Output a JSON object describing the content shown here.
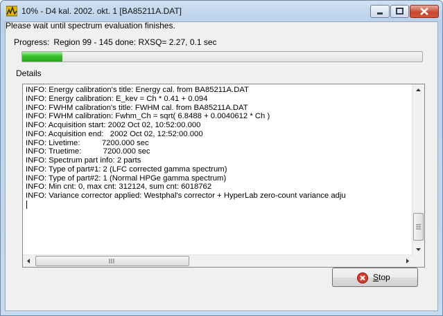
{
  "window": {
    "title": "10% - D4 kal. 2002. okt. 1 [BA85211A.DAT]"
  },
  "message": "Please wait until spectrum evaluation finishes.",
  "progress": {
    "label": "Progress:",
    "value_text": "Region 99 - 145 done: RXSQ= 2.27, 0.1 sec",
    "fraction": 0.1
  },
  "details": {
    "label": "Details",
    "lines": [
      "INFO: Energy calibration's title: Energy cal. from BA85211A.DAT",
      "INFO: Energy calibration: E_kev = Ch * 0.41 + 0.094",
      "INFO: FWHM calibration's title: FWHM cal. from BA85211A.DAT",
      "INFO: FWHM calibration: Fwhm_Ch = sqrt( 6.8488 + 0.0040612 * Ch )",
      "INFO: Acquisition start: 2002 Oct 02, 10:52:00.000",
      "INFO: Acquisition end:   2002 Oct 02, 12:52:00.000",
      "INFO: Livetime:          7200.000 sec",
      "INFO: Truetime:          7200.000 sec",
      "INFO: Spectrum part info: 2 parts",
      "INFO: Type of part#1: 2 (LFC corrected gamma spectrum)",
      "INFO: Type of part#2: 1 (Normal HPGe gamma spectrum)",
      "INFO: Min cnt: 0, max cnt: 312124, sum cnt: 6018762",
      "INFO: Variance corrector applied: Westphal's corrector + HyperLab zero-count variance adju"
    ]
  },
  "stop_button": {
    "label_mnemonic": "S",
    "label_rest": "top"
  },
  "colors": {
    "progress_fill": "#37c12a",
    "stop_icon": "#d83b2d"
  },
  "icons": {
    "app": "spectrum-app-icon",
    "stop": "stop-x-icon"
  }
}
